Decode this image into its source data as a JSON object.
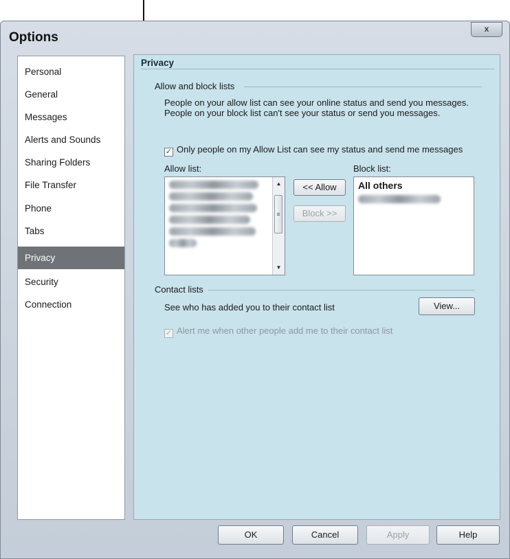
{
  "window": {
    "title": "Options",
    "close_glyph": "x"
  },
  "sidebar": {
    "items": [
      {
        "label": "Personal",
        "selected": false
      },
      {
        "label": "General",
        "selected": false
      },
      {
        "label": "Messages",
        "selected": false
      },
      {
        "label": "Alerts and Sounds",
        "selected": false
      },
      {
        "label": "Sharing Folders",
        "selected": false
      },
      {
        "label": "File Transfer",
        "selected": false
      },
      {
        "label": "Phone",
        "selected": false
      },
      {
        "label": "Tabs",
        "selected": false
      },
      {
        "label": "Privacy",
        "selected": true
      },
      {
        "label": "Security",
        "selected": false
      },
      {
        "label": "Connection",
        "selected": false
      }
    ]
  },
  "privacy": {
    "section_title": "Privacy",
    "allow_block_group": "Allow and block lists",
    "description": "People on your allow list can see your online status and send you messages.  People on your block list can't see your status or send you messages.",
    "allow_only_checkbox": {
      "label": "Only people on my Allow List can see my status and send me messages",
      "checked": true
    },
    "allow_list_label": "Allow list:",
    "block_list_label": "Block list:",
    "allow_button": "<< Allow",
    "block_button": "Block >>",
    "block_list_heading": "All others",
    "contact_group": "Contact lists",
    "contact_text": "See who has added you to their contact list",
    "view_button": "View...",
    "alert_checkbox": {
      "label": "Alert me when other people add me to their contact list",
      "checked": true,
      "disabled": true
    }
  },
  "footer": {
    "ok": "OK",
    "cancel": "Cancel",
    "apply": "Apply",
    "help": "Help"
  },
  "icons": {
    "annotation": "arrow-pointer-icon",
    "scroll_up": "arrow-up-icon",
    "scroll_down": "arrow-down-icon"
  }
}
